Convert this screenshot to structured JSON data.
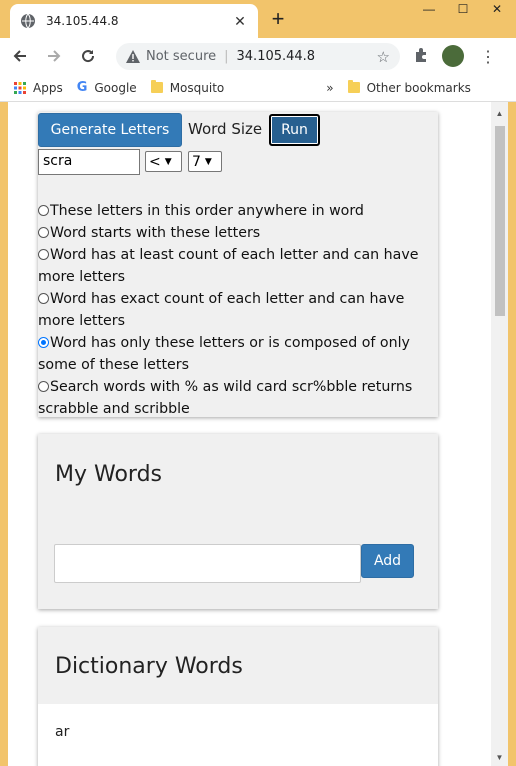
{
  "browser": {
    "tab_title": "34.105.44.8",
    "not_secure": "Not secure",
    "url": "34.105.44.8",
    "bookmarks": {
      "apps": "Apps",
      "google": "Google",
      "mosquito": "Mosquito",
      "more": "»",
      "other": "Other bookmarks"
    },
    "window_controls": {
      "minimize": "—",
      "maximize": "☐",
      "close": "✕"
    }
  },
  "generator": {
    "generate_label": "Generate Letters",
    "word_size_label": "Word Size",
    "run_label": "Run",
    "letters_value": "scra",
    "operator_value": "<",
    "size_value": "7",
    "options": [
      {
        "label": "These letters in this order anywhere in word",
        "checked": false
      },
      {
        "label": "Word starts with these letters",
        "checked": false
      },
      {
        "label": "Word has at least count of each letter and can have more letters",
        "checked": false
      },
      {
        "label": "Word has exact count of each letter and can have more letters",
        "checked": false
      },
      {
        "label": "Word has only these letters or is composed of only some of these letters",
        "checked": true
      },
      {
        "label": "Search words with % as wild card scr%bble returns scrabble and scribble",
        "checked": false
      }
    ]
  },
  "my_words": {
    "heading": "My Words",
    "input_value": "",
    "add_label": "Add"
  },
  "dictionary": {
    "heading": "Dictionary Words",
    "first_word": "ar"
  },
  "colors": {
    "accent": "#337ab7",
    "frame": "#f2c46b",
    "panel": "#f0f0f0",
    "radio_selected": "#0075ff"
  }
}
